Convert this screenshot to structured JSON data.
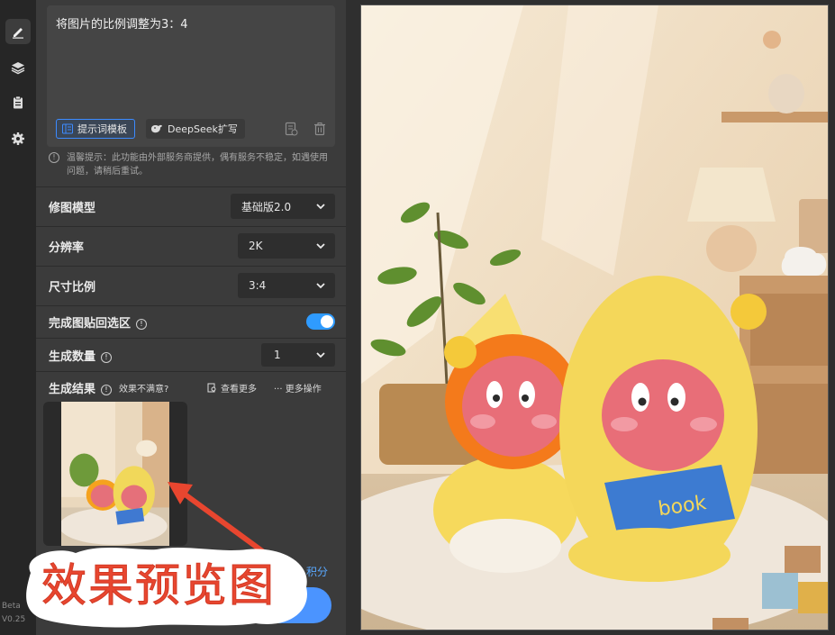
{
  "rail": {
    "icons": [
      "edit-icon",
      "layers-icon",
      "clipboard-icon",
      "gear-icon"
    ],
    "version_prefix": "Beta",
    "version": "V0.25"
  },
  "prompt": {
    "text": "将图片的比例调整为3：4",
    "template_button": "提示词模板",
    "deepseek_button": "DeepSeek扩写"
  },
  "tip": {
    "text": "温馨提示：此功能由外部服务商提供，偶有服务不稳定，如遇使用问题，请稍后重试。"
  },
  "settings": {
    "model_label": "修图模型",
    "model_value": "基础版2.0",
    "resolution_label": "分辨率",
    "resolution_value": "2K",
    "ratio_label": "尺寸比例",
    "ratio_value": "3:4",
    "paste_back_label": "完成图贴回选区",
    "paste_back_on": true,
    "count_label": "生成数量",
    "count_value": "1"
  },
  "results": {
    "title": "生成结果",
    "unsatisfied": "效果不满意?",
    "view_more": "查看更多",
    "more_ops": "··· 更多操作"
  },
  "footer": {
    "credits_text": "积分"
  },
  "annotation": {
    "text": "效果预览图",
    "color": "#e8462f"
  },
  "colors": {
    "accent": "#3d8bff",
    "toggle": "#2f9bff"
  }
}
